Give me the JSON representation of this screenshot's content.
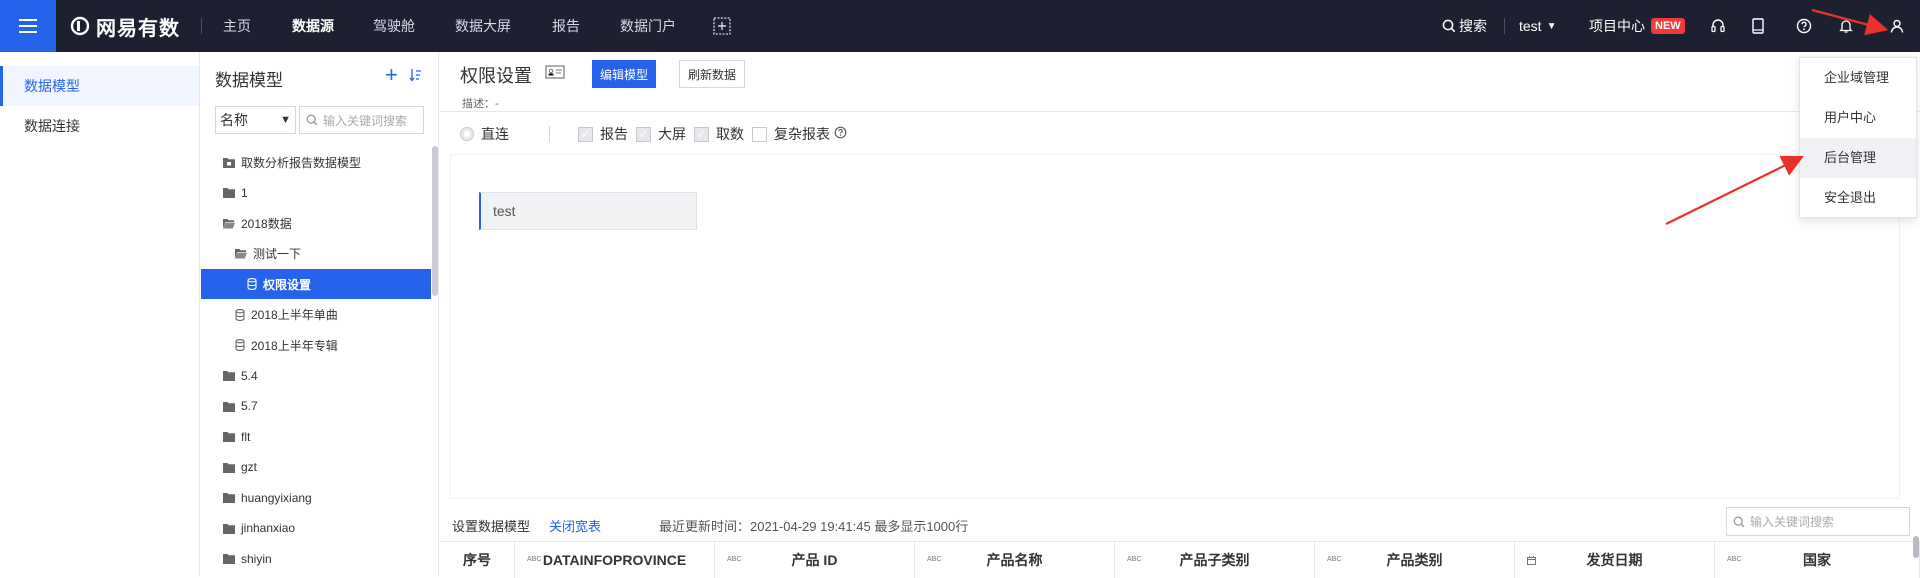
{
  "topbar": {
    "brand": "网易有数",
    "nav": [
      "主页",
      "数据源",
      "驾驶舱",
      "数据大屏",
      "报告",
      "数据门户"
    ],
    "active_nav": "数据源",
    "search_label": "搜索",
    "user_label": "test",
    "project_center": "项目中心",
    "new_badge": "NEW",
    "icons": [
      "headset-icon",
      "tablet-icon",
      "help-icon",
      "bell-icon",
      "user-icon"
    ]
  },
  "sidebar": {
    "items": [
      {
        "label": "数据模型",
        "active": true
      },
      {
        "label": "数据连接",
        "active": false
      }
    ]
  },
  "tree": {
    "title": "数据模型",
    "select_value": "名称",
    "search_placeholder": "输入关键词搜索",
    "items": [
      {
        "label": "取数分析报告数据模型",
        "icon": "folder-special-icon",
        "level": 0
      },
      {
        "label": "1",
        "icon": "folder-icon",
        "level": 0
      },
      {
        "label": "2018数据",
        "icon": "folder-open-icon",
        "level": 0
      },
      {
        "label": "测试一下",
        "icon": "folder-open-icon",
        "level": 1
      },
      {
        "label": "权限设置",
        "icon": "database-icon",
        "level": 2,
        "selected": true
      },
      {
        "label": "2018上半年单曲",
        "icon": "database-icon",
        "level": 1
      },
      {
        "label": "2018上半年专辑",
        "icon": "database-icon",
        "level": 1
      },
      {
        "label": "5.4",
        "icon": "folder-icon",
        "level": 0
      },
      {
        "label": "5.7",
        "icon": "folder-icon",
        "level": 0
      },
      {
        "label": "flt",
        "icon": "folder-icon",
        "level": 0
      },
      {
        "label": "gzt",
        "icon": "folder-icon",
        "level": 0
      },
      {
        "label": "huangyixiang",
        "icon": "folder-icon",
        "level": 0
      },
      {
        "label": "jinhanxiao",
        "icon": "folder-icon",
        "level": 0
      },
      {
        "label": "shiyin",
        "icon": "folder-icon",
        "level": 0
      }
    ]
  },
  "main": {
    "title": "权限设置",
    "edit_label": "编辑模型",
    "refresh_label": "刷新数据",
    "desc": "描述：-",
    "mode_label": "直连",
    "options": [
      {
        "label": "报告",
        "checked": true
      },
      {
        "label": "大屏",
        "checked": true
      },
      {
        "label": "取数",
        "checked": false
      },
      {
        "label": "复杂报表",
        "checked": false
      }
    ],
    "field_value": "test"
  },
  "bottom": {
    "set_model": "设置数据模型",
    "close_wide": "关闭宽表",
    "update_info": "最近更新时间：2021-04-29 19:41:45 最多显示1000行",
    "search_placeholder": "输入关键词搜索",
    "columns": [
      {
        "label": "序号",
        "type": ""
      },
      {
        "label": "DATAINFOPROVINCE",
        "type": "ABC"
      },
      {
        "label": "产品 ID",
        "type": "ABC"
      },
      {
        "label": "产品名称",
        "type": "ABC"
      },
      {
        "label": "产品子类别",
        "type": "ABC"
      },
      {
        "label": "产品类别",
        "type": "ABC"
      },
      {
        "label": "发货日期",
        "type": "date"
      },
      {
        "label": "国家",
        "type": "ABC"
      }
    ]
  },
  "dropdown": {
    "items": [
      "企业域管理",
      "用户中心",
      "后台管理",
      "安全退出"
    ],
    "hovered": "后台管理"
  },
  "colors": {
    "accent": "#2563eb",
    "topbar": "#1c2030",
    "badge": "#ef3b3b",
    "annotation": "#e8322a"
  }
}
